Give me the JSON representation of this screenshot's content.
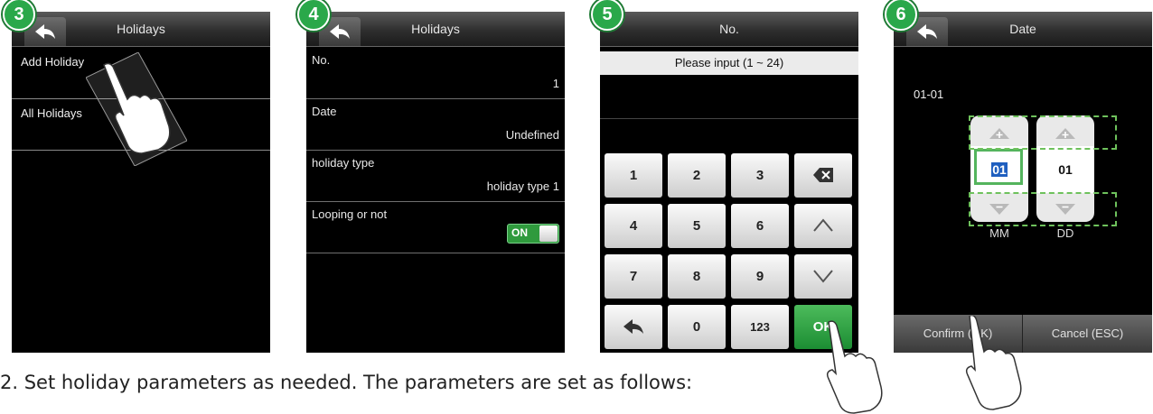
{
  "steps": [
    "3",
    "4",
    "5",
    "6"
  ],
  "screen3": {
    "title": "Holidays",
    "menu": [
      "Add Holiday",
      "All Holidays"
    ]
  },
  "screen4": {
    "title": "Holidays",
    "fields": [
      {
        "label": "No.",
        "value": "1"
      },
      {
        "label": "Date",
        "value": "Undefined"
      },
      {
        "label": "holiday type",
        "value": "holiday type 1"
      },
      {
        "label": "Looping or not",
        "toggle": "ON"
      }
    ]
  },
  "screen5": {
    "title": "No.",
    "prompt": "Please input (1 ~ 24)",
    "keys": [
      "1",
      "2",
      "3",
      "backspace-icon",
      "4",
      "5",
      "6",
      "up-arrow-icon",
      "7",
      "8",
      "9",
      "down-arrow-icon",
      "back-arrow-icon",
      "0",
      "123",
      "OK"
    ]
  },
  "screen6": {
    "title": "Date",
    "readout": "01-01",
    "month": "01",
    "day": "01",
    "month_label": "MM",
    "day_label": "DD",
    "confirm": "Confirm (OK)",
    "cancel": "Cancel (ESC)"
  },
  "caption": "2. Set holiday parameters as needed. The parameters are set as follows:",
  "colors": {
    "green": "#2aa84a",
    "screen_bg": "#000000",
    "toggle_on": "#2f9a3d"
  }
}
